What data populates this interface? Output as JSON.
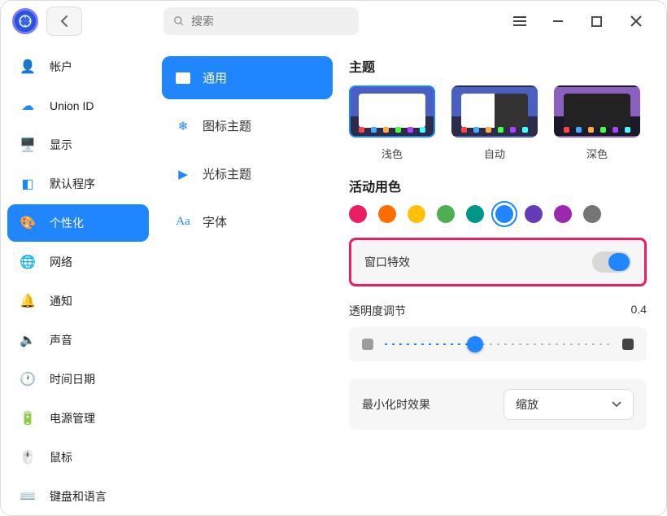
{
  "search": {
    "placeholder": "搜索"
  },
  "sidebar": {
    "items": [
      {
        "label": "帐户"
      },
      {
        "label": "Union ID"
      },
      {
        "label": "显示"
      },
      {
        "label": "默认程序"
      },
      {
        "label": "个性化"
      },
      {
        "label": "网络"
      },
      {
        "label": "通知"
      },
      {
        "label": "声音"
      },
      {
        "label": "时间日期"
      },
      {
        "label": "电源管理"
      },
      {
        "label": "鼠标"
      },
      {
        "label": "键盘和语言"
      }
    ],
    "active_index": 4
  },
  "tabs": {
    "items": [
      {
        "label": "通用"
      },
      {
        "label": "图标主题"
      },
      {
        "label": "光标主题"
      },
      {
        "label": "字体"
      }
    ],
    "active_index": 0
  },
  "theme_section": {
    "title": "主题",
    "options": [
      {
        "label": "浅色"
      },
      {
        "label": "自动"
      },
      {
        "label": "深色"
      }
    ],
    "selected_index": 0
  },
  "accent_section": {
    "title": "活动用色",
    "colors": [
      "#e91e63",
      "#ff6d00",
      "#ffc107",
      "#4caf50",
      "#009688",
      "#1f86ff",
      "#673ab7",
      "#9c27b0",
      "#757575"
    ],
    "selected_index": 5
  },
  "window_effect": {
    "label": "窗口特效",
    "enabled": true
  },
  "opacity": {
    "label": "透明度调节",
    "value_text": "0.4",
    "percent": 40
  },
  "minimize": {
    "label": "最小化时效果",
    "selected": "缩放"
  }
}
